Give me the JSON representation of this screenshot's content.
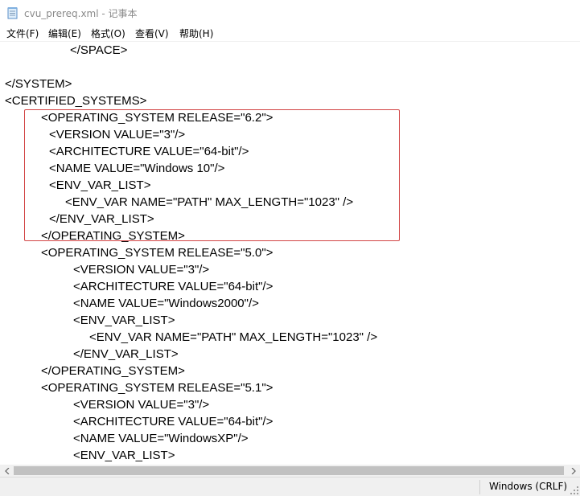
{
  "window": {
    "title": "cvu_prereq.xml - 记事本"
  },
  "menu": [
    {
      "id": "file",
      "label": "文件(F)"
    },
    {
      "id": "edit",
      "label": "编辑(E)"
    },
    {
      "id": "format",
      "label": "格式(O)"
    },
    {
      "id": "view",
      "label": "查看(V)"
    },
    {
      "id": "help",
      "label": "帮助(H)"
    }
  ],
  "editor": {
    "lines": [
      "</SPACE>",
      "",
      "</SYSTEM>",
      "<CERTIFIED_SYSTEMS>",
      "<OPERATING_SYSTEM RELEASE=\"6.2\">",
      "<VERSION VALUE=\"3\"/>",
      "<ARCHITECTURE VALUE=\"64-bit\"/>",
      "<NAME VALUE=\"Windows 10\"/>",
      "<ENV_VAR_LIST>",
      "<ENV_VAR NAME=\"PATH\" MAX_LENGTH=\"1023\" />",
      "</ENV_VAR_LIST>",
      "</OPERATING_SYSTEM>",
      "<OPERATING_SYSTEM RELEASE=\"5.0\">",
      "<VERSION VALUE=\"3\"/>",
      "<ARCHITECTURE VALUE=\"64-bit\"/>",
      "<NAME VALUE=\"Windows2000\"/>",
      "<ENV_VAR_LIST>",
      "<ENV_VAR NAME=\"PATH\" MAX_LENGTH=\"1023\" />",
      "</ENV_VAR_LIST>",
      "</OPERATING_SYSTEM>",
      "<OPERATING_SYSTEM RELEASE=\"5.1\">",
      "<VERSION VALUE=\"3\"/>",
      "<ARCHITECTURE VALUE=\"64-bit\"/>",
      "<NAME VALUE=\"WindowsXP\"/>",
      "<ENV_VAR_LIST>"
    ]
  },
  "status": {
    "encoding": "Windows (CRLF)"
  },
  "colors": {
    "highlight_border": "#d24545",
    "title_text": "#8a8a8a"
  },
  "icons": {
    "app": "notepad-icon",
    "scroll_left": "chevron-left-icon",
    "scroll_right": "chevron-right-icon"
  }
}
